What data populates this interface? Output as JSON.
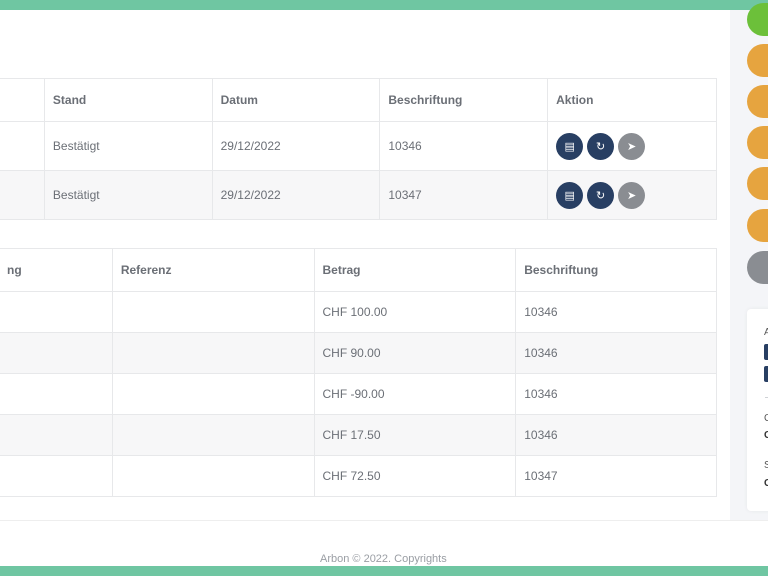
{
  "side_status_pills": [
    {
      "name": "green-status-pill",
      "color": "#6cc03a"
    },
    {
      "name": "orange-status-pill",
      "color": "#e6a43f"
    },
    {
      "name": "orange-status-pill",
      "color": "#e6a43f"
    },
    {
      "name": "orange-status-pill",
      "color": "#e6a43f"
    },
    {
      "name": "orange-status-pill",
      "color": "#e6a43f"
    },
    {
      "name": "orange-status-pill",
      "color": "#e6a43f"
    },
    {
      "name": "grey-status-pill",
      "color": "#8a8d92"
    }
  ],
  "side_card": {
    "frag_a": "A",
    "frag_c1": "C",
    "frag_c2": "C",
    "frag_s": "S",
    "frag_c3": "C"
  },
  "orders_table": {
    "headers": {
      "stand": "Stand",
      "datum": "Datum",
      "beschriftung": "Beschriftung",
      "aktion": "Aktion"
    },
    "rows": [
      {
        "stand": "Bestätigt",
        "datum": "29/12/2022",
        "beschriftung": "10346"
      },
      {
        "stand": "Bestätigt",
        "datum": "29/12/2022",
        "beschriftung": "10347"
      }
    ],
    "action_icons": [
      "document-icon",
      "refresh-icon",
      "send-icon"
    ]
  },
  "payments_table": {
    "headers": {
      "col1_partial": "ng",
      "referenz": "Referenz",
      "betrag": "Betrag",
      "beschriftung": "Beschriftung"
    },
    "rows": [
      {
        "referenz": "",
        "betrag": "CHF 100.00",
        "beschriftung": "10346"
      },
      {
        "referenz": "",
        "betrag": "CHF 90.00",
        "beschriftung": "10346"
      },
      {
        "referenz": "",
        "betrag": "CHF -90.00",
        "beschriftung": "10346"
      },
      {
        "referenz": "",
        "betrag": "CHF 17.50",
        "beschriftung": "10346"
      },
      {
        "referenz": "",
        "betrag": "CHF 72.50",
        "beschriftung": "10347"
      }
    ]
  },
  "footer": {
    "text": "Arbon © 2022. Copyrights"
  },
  "colors": {
    "accent_bar": "#6fc6a2",
    "action_dark": "#283f63",
    "action_grey": "#8a8d92"
  }
}
